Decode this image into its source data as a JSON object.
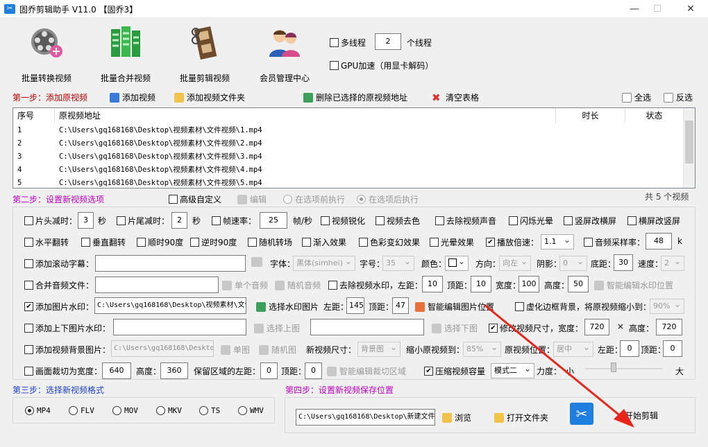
{
  "window": {
    "title": "固乔剪辑助手 V11.0  【固乔3】",
    "minimize": "—",
    "maximize": "☐",
    "close": "✕"
  },
  "toolbar": {
    "batch_convert": "批量转换视频",
    "batch_merge": "批量合并视频",
    "batch_edit": "批量剪辑视频",
    "member": "会员管理中心",
    "multithread_label": "多线程",
    "thread_count": "2",
    "thread_unit": "个线程",
    "gpu_label": "GPU加速（用显卡解码）"
  },
  "step1": {
    "title": "第一步：添加原视频",
    "add_video": "添加视频",
    "add_folder": "添加视频文件夹",
    "delete_selected": "删除已选择的原视频地址",
    "clear_table": "清空表格",
    "select_all": "全选",
    "invert_select": "反选"
  },
  "table": {
    "headers": [
      "序号",
      "原视频地址",
      "时长",
      "状态"
    ],
    "rows": [
      {
        "no": "1",
        "path": "C:\\Users\\gq168168\\Desktop\\视频素材\\文件视频\\1.mp4"
      },
      {
        "no": "2",
        "path": "C:\\Users\\gq168168\\Desktop\\视频素材\\文件视频\\2.mp4"
      },
      {
        "no": "3",
        "path": "C:\\Users\\gq168168\\Desktop\\视频素材\\文件视频\\3.mp4"
      },
      {
        "no": "4",
        "path": "C:\\Users\\gq168168\\Desktop\\视频素材\\文件视频\\4.mp4"
      },
      {
        "no": "5",
        "path": "C:\\Users\\gq168168\\Desktop\\视频素材\\文件视频\\5.mp4"
      }
    ],
    "total": "共 5 个视频"
  },
  "step2": {
    "title": "第二步：设置新视频选项",
    "advanced_custom": "高级自定义",
    "edit": "编辑",
    "before_exec": "在选项前执行",
    "after_exec": "在选项后执行",
    "r1": {
      "head_cut": "片头减时：",
      "head_val": "3",
      "sec1": "秒",
      "tail_cut": "片尾减时：",
      "tail_val": "2",
      "sec2": "秒",
      "fps_reduce": "帧速率：",
      "fps_val": "25",
      "fps_unit": "帧/秒",
      "sharpen": "视频锐化",
      "decolor": "视频去色",
      "remove_audio": "去除视频声音",
      "flash": "闪烁光晕",
      "v2h": "竖屏改横屏",
      "h2v": "横屏改竖屏"
    },
    "r2": {
      "hflip": "水平翻转",
      "vflip": "垂直翻转",
      "rot90": "顺时90度",
      "rotm90": "逆时90度",
      "random_trans": "随机转场",
      "fade_in": "渐入效果",
      "color_shift": "色彩变幻效果",
      "halo": "光晕效果",
      "speed": "播放倍速：",
      "speed_val": "1.1",
      "samplerate": "音频采样率：",
      "samplerate_val": "48",
      "samplerate_unit": "k"
    },
    "r3": {
      "scroll_sub": "添加滚动字幕：",
      "font": "字体：",
      "font_val": "黑体(simhei)",
      "size": "字号：",
      "size_val": "35",
      "color": "颜色：",
      "dir": "方向：",
      "dir_val": "向左",
      "shadow": "阴影：",
      "shadow_val": "0",
      "bottom": "底距：",
      "bottom_val": "30",
      "speed2": "速度：",
      "speed2_val": "2"
    },
    "r4": {
      "merge_audio": "合并音频文件：",
      "single_audio": "单个音频",
      "random_audio": "随机音频",
      "remove_wm": "去除视频水印，左距：",
      "left_val": "10",
      "top": "顶距：",
      "top_val": "10",
      "width": "宽度：",
      "width_val": "100",
      "height": "高度：",
      "height_val": "50",
      "smart_wm": "智能编辑水印位置"
    },
    "r5": {
      "img_wm": "添加图片水印：",
      "img_path": "C:\\Users\\gq168168\\Desktop\\视频素材\\文件视频\\",
      "select_img": "选择水印图片",
      "left": "左距：",
      "left_val": "145",
      "top": "顶距：",
      "top_val": "47",
      "smart_img": "智能编辑图片位置",
      "blur_bg": "虚化边框背景，将原视频缩小到：",
      "blur_val": "90%"
    },
    "r6": {
      "tb_img": "添加上下图片水印：",
      "sel_top": "选择上图",
      "sel_bottom": "选择下图",
      "resize": "修改视频尺寸，宽度：",
      "w_val": "720",
      "x": "×",
      "h_label": "高度：",
      "h_val": "720"
    },
    "r7": {
      "bg_img": "添加视频背景图片：",
      "bg_path": "C:\\Users\\gq168168\\Desktop\\",
      "single_img": "单图",
      "random_img": "随机图",
      "new_size": "新视频尺寸：",
      "size_val": "背景图",
      "shrink": "缩小原视频到：",
      "shrink_val": "85%",
      "pos": "原视频位置：",
      "pos_val": "居中",
      "left": "左距：",
      "left_val": "0",
      "top": "顶距：",
      "top_val": "0"
    },
    "r8": {
      "crop": "画面裁切为宽度：",
      "crop_w": "640",
      "h": "高度：",
      "crop_h": "360",
      "keep_left": "保留区域的左距：",
      "keep_left_val": "0",
      "top": "顶距：",
      "top_val": "0",
      "smart_crop": "智能编辑裁切区域",
      "compress": "压缩视频容量",
      "mode_val": "模式二",
      "strength": "力度：",
      "small": "小",
      "big": "大",
      "strength_level": 0.35
    }
  },
  "step3": {
    "title": "第三步：选择新视频格式",
    "formats": [
      "MP4",
      "FLV",
      "MOV",
      "MKV",
      "TS",
      "WMV"
    ],
    "selected": "MP4"
  },
  "step4": {
    "title": "第四步：设置新视频保存位置",
    "path": "C:\\Users\\gq168168\\Desktop\\新建文件夹",
    "browse": "浏览",
    "open_folder": "打开文件夹",
    "start": "开始剪辑"
  },
  "colors": {
    "step_red": "#c00000",
    "step_magenta": "#c000c0",
    "step_blue": "#1c3fcf",
    "arrow": "#e8261b",
    "accent": "#1e7fe0"
  }
}
